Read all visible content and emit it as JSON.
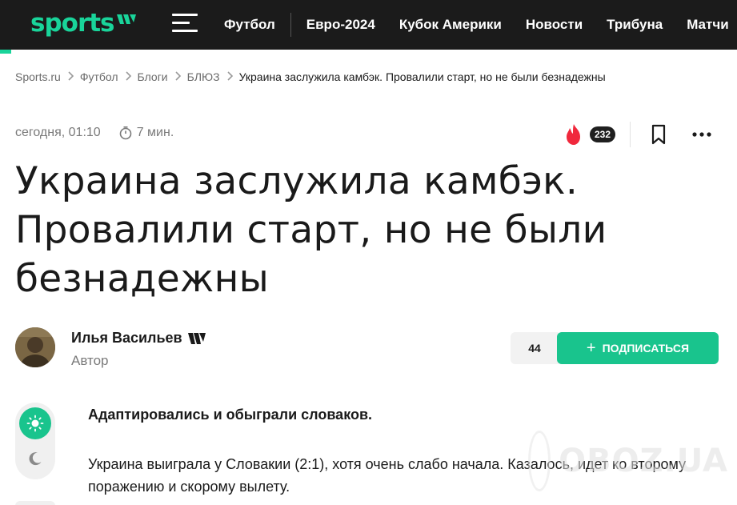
{
  "header": {
    "logo_text": "sports",
    "nav": [
      {
        "label": "Футбол"
      },
      {
        "label": "Евро-2024"
      },
      {
        "label": "Кубок Америки"
      },
      {
        "label": "Новости"
      },
      {
        "label": "Трибуна"
      },
      {
        "label": "Матчи"
      }
    ]
  },
  "breadcrumb": [
    "Sports.ru",
    "Футбол",
    "Блоги",
    "БЛЮЗ",
    "Украина заслужила камбэк. Провалили старт, но не были безнадежны"
  ],
  "meta": {
    "date": "сегодня, 01:10",
    "read_time": "7 мин.",
    "reactions_count": "232"
  },
  "article": {
    "title": "Украина заслужила камбэк. Провалили старт, но не были безнадежны",
    "lead": "Адаптировались и обыграли словаков.",
    "paragraph": "Украина выиграла у Словакии (2:1), хотя очень слабо начала. Казалось, идет ко второму поражению и скорому вылету."
  },
  "author": {
    "name": "Илья Васильев",
    "role": "Автор",
    "subscribers": "44",
    "subscribe_label": "ПОДПИСАТЬСЯ"
  },
  "watermark": {
    "text": "OBOZ.UA"
  },
  "colors": {
    "brand": "#19d49a",
    "button": "#19c48d",
    "header_bg": "#1b1b1b",
    "fire": "#f0283c"
  }
}
